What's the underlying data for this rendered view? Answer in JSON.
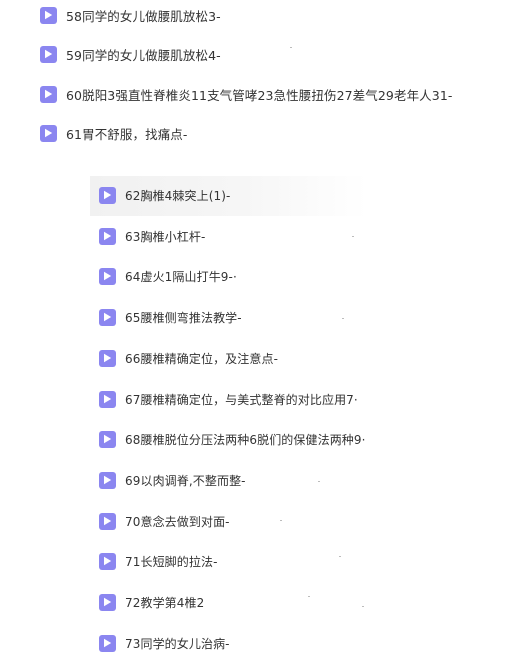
{
  "colors": {
    "icon_bg": "#8b86f0",
    "icon_play": "#ffffff",
    "text": "#333333",
    "highlight_row": "#f3f3f3"
  },
  "icon": "play-icon",
  "top_items": [
    {
      "label": "58同学的女儿做腰肌放松3-"
    },
    {
      "label": "59同学的女儿做腰肌放松4-"
    },
    {
      "label": "60脱阳3强直性脊椎炎11支气管哮23急性腰扭伤27差气29老年人31-"
    },
    {
      "label": "61胃不舒服，找痛点-"
    }
  ],
  "sub_items": [
    {
      "label": "62胸椎4棘突上(1)-"
    },
    {
      "label": "63胸椎小杠杆-"
    },
    {
      "label": "64虚火1隔山打牛9-·"
    },
    {
      "label": "65腰椎侧弯推法教学-"
    },
    {
      "label": "66腰椎精确定位，及注意点-"
    },
    {
      "label": "67腰椎精确定位，与美式整脊的对比应用7·"
    },
    {
      "label": "68腰椎脱位分压法两种6脱们的保健法两种9·"
    },
    {
      "label": "69以肉调脊,不整而整-"
    },
    {
      "label": "70意念去做到对面-"
    },
    {
      "label": "71长短脚的拉法-"
    },
    {
      "label": "72教学第4椎2"
    },
    {
      "label": "73同学的女儿治病-"
    }
  ]
}
